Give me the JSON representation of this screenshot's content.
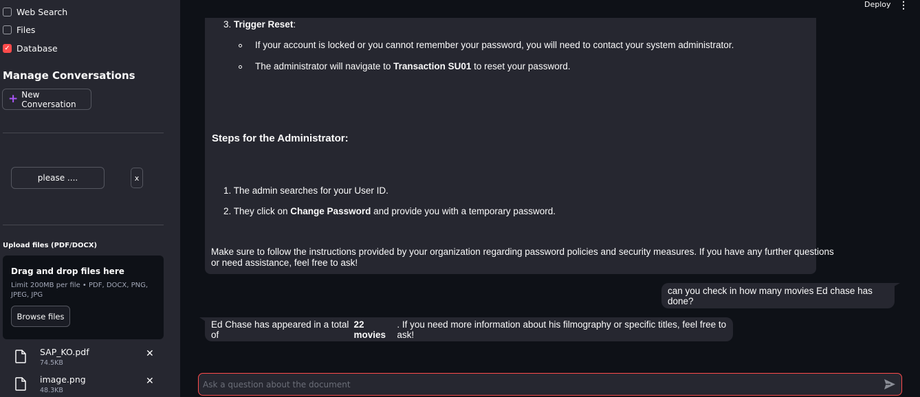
{
  "sidebar": {
    "checkboxes": [
      {
        "label": "Web Search",
        "checked": false
      },
      {
        "label": "Files",
        "checked": false
      },
      {
        "label": "Database",
        "checked": true
      }
    ],
    "manage_heading": "Manage Conversations",
    "new_conversation_label": "New Conversation",
    "conversation_item_label": "please ....",
    "delete_conversation_label": "x",
    "upload_label": "Upload files (PDF/DOCX)",
    "dropzone": {
      "title": "Drag and drop files here",
      "limit": "Limit 200MB per file • PDF, DOCX, PNG, JPEG, JPG",
      "browse_label": "Browse files"
    },
    "files": [
      {
        "name": "SAP_KO.pdf",
        "size": "74.5KB"
      },
      {
        "name": "image.png",
        "size": "48.3KB"
      }
    ]
  },
  "header": {
    "deploy_label": "Deploy",
    "menu_icon": "kebab-menu-icon"
  },
  "assistant_message_1": {
    "step3_num": "3.",
    "step3_title": "Trigger Reset",
    "step3_colon": ":",
    "bullet1": "If your account is locked or you cannot remember your password, you will need to contact your system administrator.",
    "bullet2_pre": "The administrator will navigate to ",
    "bullet2_bold": "Transaction SU01",
    "bullet2_post": " to reset your password.",
    "admin_heading": "Steps for the Administrator:",
    "admin_step1": "1. The admin searches for your User ID.",
    "admin_step2_pre": "2. They click on ",
    "admin_step2_bold": "Change Password",
    "admin_step2_post": " and provide you with a temporary password.",
    "closing_line1": "Make sure to follow the instructions provided by your organization regarding password policies and security measures. If you have any further questions",
    "closing_line2": "or need assistance, feel free to ask!"
  },
  "user_message": "can you check in how many movies Ed chase has done?",
  "assistant_message_2": {
    "pre": "Ed Chase has appeared in a total of ",
    "bold": "22 movies",
    "post": ". If you need more information about his filmography or specific titles, feel free to ask!"
  },
  "chat_input": {
    "placeholder": "Ask a question about the document",
    "value": ""
  },
  "colors": {
    "accent": "#ff4b4b",
    "plus_icon": "#a855f7",
    "sidebar_bg": "#262730",
    "main_bg": "#0e1117"
  }
}
